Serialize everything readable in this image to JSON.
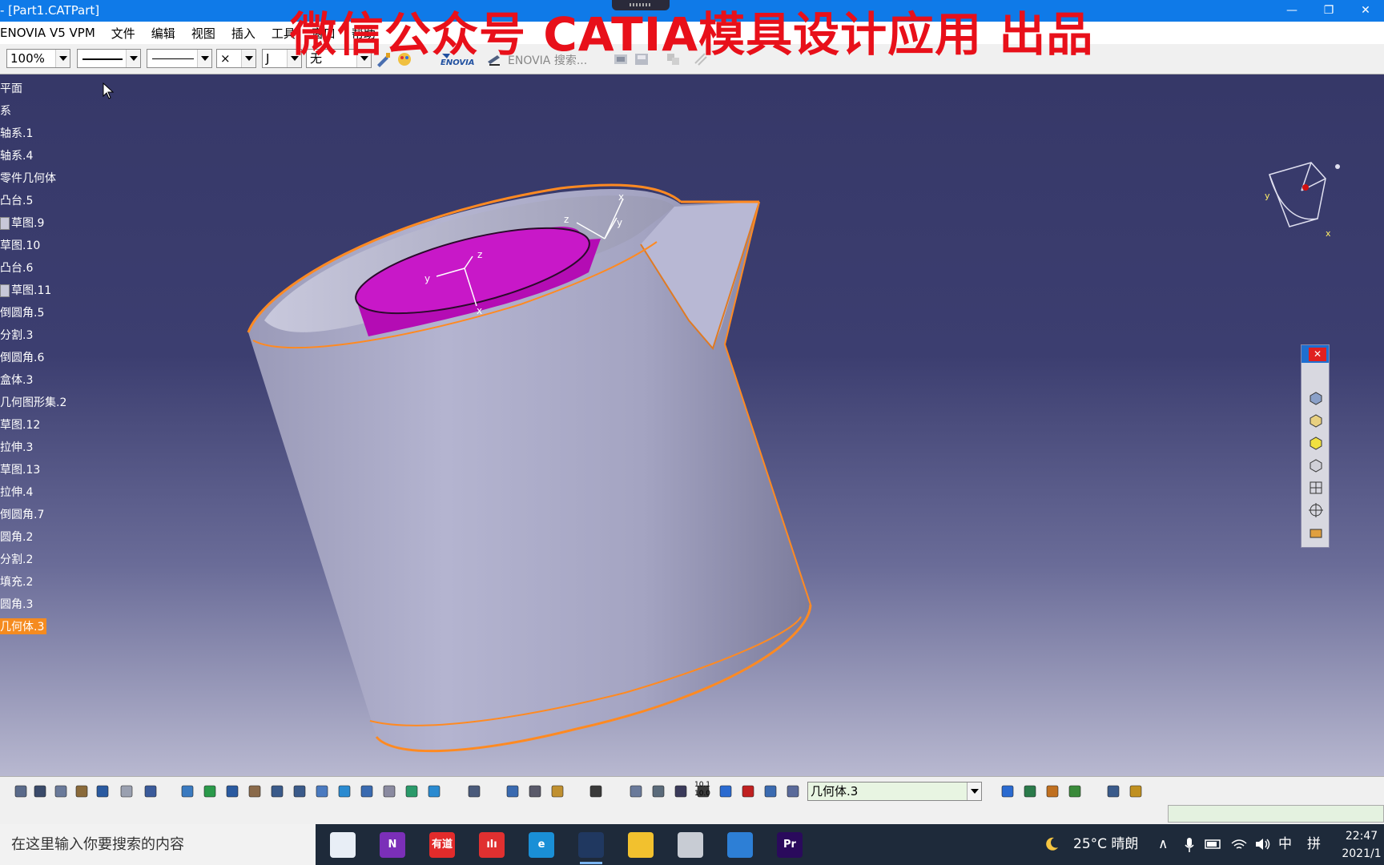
{
  "window": {
    "title": "- [Part1.CATPart]",
    "controls": [
      "—",
      "❐",
      "✕"
    ]
  },
  "menu": [
    "ENOVIA V5 VPM",
    "文件",
    "编辑",
    "视图",
    "插入",
    "工具",
    "窗口",
    "帮助"
  ],
  "watermark": "微信公众号 CATIA模具设计应用 出品",
  "toolbar": {
    "zoom_value": "100%",
    "layer_value": "无",
    "thickness_value": "×",
    "point_value": "J",
    "enovia_search": "ENOVIA 搜索..."
  },
  "tree": {
    "items": [
      {
        "label": "平面",
        "icon": false,
        "selected": false
      },
      {
        "label": "系",
        "icon": false,
        "selected": false
      },
      {
        "label": "轴系.1",
        "icon": false,
        "selected": false
      },
      {
        "label": "轴系.4",
        "icon": false,
        "selected": false
      },
      {
        "label": "零件几何体",
        "icon": false,
        "selected": false
      },
      {
        "label": "凸台.5",
        "icon": false,
        "selected": false
      },
      {
        "label": "草图.9",
        "icon": true,
        "selected": false
      },
      {
        "label": "草图.10",
        "icon": false,
        "selected": false
      },
      {
        "label": "凸台.6",
        "icon": false,
        "selected": false
      },
      {
        "label": "草图.11",
        "icon": true,
        "selected": false
      },
      {
        "label": "倒圆角.5",
        "icon": false,
        "selected": false
      },
      {
        "label": "分割.3",
        "icon": false,
        "selected": false
      },
      {
        "label": "倒圆角.6",
        "icon": false,
        "selected": false
      },
      {
        "label": "盒体.3",
        "icon": false,
        "selected": false
      },
      {
        "label": "几何图形集.2",
        "icon": false,
        "selected": false
      },
      {
        "label": "草图.12",
        "icon": false,
        "selected": false
      },
      {
        "label": "拉伸.3",
        "icon": false,
        "selected": false
      },
      {
        "label": "草图.13",
        "icon": false,
        "selected": false
      },
      {
        "label": "拉伸.4",
        "icon": false,
        "selected": false
      },
      {
        "label": "倒圆角.7",
        "icon": false,
        "selected": false
      },
      {
        "label": "圆角.2",
        "icon": false,
        "selected": false
      },
      {
        "label": "分割.2",
        "icon": false,
        "selected": false
      },
      {
        "label": "填充.2",
        "icon": false,
        "selected": false
      },
      {
        "label": "圆角.3",
        "icon": false,
        "selected": false
      },
      {
        "label": "几何体.3",
        "icon": false,
        "selected": true
      }
    ]
  },
  "axis_labels": {
    "x": "x",
    "y": "y",
    "z": "z"
  },
  "bottom_toolbar": {
    "current_body": "几何体.3",
    "scale_label_top": "10.1",
    "scale_label_bottom": "10.0"
  },
  "taskbar": {
    "search_placeholder": "在这里输入你要搜索的内容",
    "apps": [
      {
        "name": "CATIA",
        "label": "",
        "color": "#e8eef6"
      },
      {
        "name": "OneNote",
        "label": "N",
        "color": "#7b2fb8"
      },
      {
        "name": "有道",
        "label": "有道",
        "color": "#e22b2b"
      },
      {
        "name": "Audio",
        "label": "ılı",
        "color": "#e03030"
      },
      {
        "name": "Edge",
        "label": "e",
        "color": "#1a8fd6"
      },
      {
        "name": "CATIA-active",
        "label": "",
        "color": "#203860"
      },
      {
        "name": "Explorer",
        "label": "",
        "color": "#f2c12e"
      },
      {
        "name": "Remote",
        "label": "",
        "color": "#c8ccd4"
      },
      {
        "name": "Photos",
        "label": "",
        "color": "#2d7fd6"
      },
      {
        "name": "Premiere",
        "label": "Pr",
        "color": "#2a0a5c"
      }
    ],
    "weather": "25°C 晴朗",
    "ime": "中",
    "ime2": "拼",
    "time": "22:47",
    "date": "2021/1"
  },
  "colors": {
    "accent": "#0f7ae8",
    "selected": "#f58b1f",
    "highlight_edge": "#ff8a22",
    "inner_body": "#c010c0",
    "watermark": "#e8101a"
  }
}
